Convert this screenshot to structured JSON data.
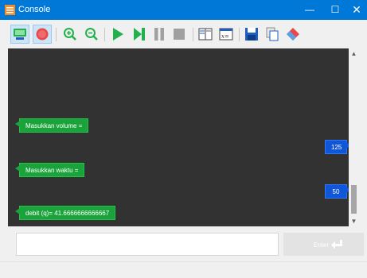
{
  "window": {
    "title": "Console",
    "minimize_glyph": "—",
    "maximize_glyph": "☐",
    "close_glyph": "✕"
  },
  "toolbar": {
    "buttons": [
      {
        "name": "console-view-icon",
        "active": true
      },
      {
        "name": "record-icon",
        "active": true
      },
      {
        "name": "zoom-in-icon"
      },
      {
        "name": "zoom-out-icon"
      },
      {
        "name": "play-icon"
      },
      {
        "name": "step-icon"
      },
      {
        "name": "pause-icon"
      },
      {
        "name": "stop-icon"
      },
      {
        "name": "split-view-icon"
      },
      {
        "name": "variables-icon"
      },
      {
        "name": "save-icon"
      },
      {
        "name": "copy-icon"
      },
      {
        "name": "eraser-icon"
      }
    ],
    "colors": {
      "green": "#22b14c",
      "gray": "#a0a0a0",
      "red": "#e8484a",
      "blue": "#1f5fbf"
    }
  },
  "console": {
    "background": "#323232",
    "messages": [
      {
        "type": "output",
        "text": "Masukkan volume ="
      },
      {
        "type": "input",
        "text": "125"
      },
      {
        "type": "output",
        "text": "Masukkan waktu ="
      },
      {
        "type": "input",
        "text": "50"
      },
      {
        "type": "output",
        "text": "debit (q)= 41.6666666666667"
      }
    ]
  },
  "input": {
    "value": "",
    "enter_label": "Enter"
  }
}
